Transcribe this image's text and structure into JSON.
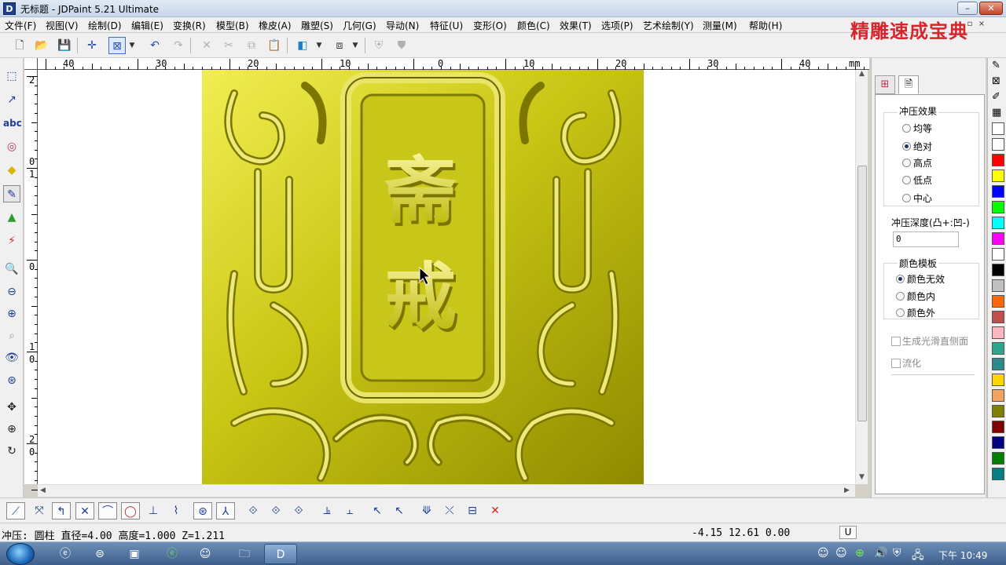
{
  "window": {
    "title": "无标题 - JDPaint 5.21 Ultimate",
    "app_icon": "D",
    "brand_overlay": "精雕速成宝典",
    "controls": [
      "–",
      "❐",
      "✕"
    ]
  },
  "menu": {
    "items": [
      "文件(F)",
      "视图(V)",
      "绘制(D)",
      "编辑(E)",
      "变换(R)",
      "模型(B)",
      "橡皮(A)",
      "雕塑(S)",
      "几何(G)",
      "导动(N)",
      "特征(U)",
      "变形(O)",
      "颜色(C)",
      "效果(T)",
      "选项(P)",
      "艺术绘制(Y)",
      "测量(M)",
      "帮助(H)"
    ]
  },
  "toolbar": {
    "icons": [
      "new-file-icon",
      "open-folder-icon",
      "save-icon",
      "crosshair-icon",
      "select-box-icon",
      "dropdown-icon",
      "undo-icon",
      "redo-icon",
      "delete-icon",
      "cut-icon",
      "copy-icon",
      "paste-icon",
      "color-fill-icon",
      "view-cube-icon",
      "shield-left-icon",
      "shield-right-icon"
    ]
  },
  "rulers": {
    "unit": "mm",
    "h_labels": [
      "40",
      "30",
      "20",
      "10",
      "0",
      "10",
      "20",
      "30",
      "40"
    ],
    "v_labels": [
      "2",
      "0",
      "1",
      "0",
      "0",
      "1",
      "0",
      "2",
      "0"
    ]
  },
  "model": {
    "characters": [
      "斋",
      "戒"
    ],
    "primary_color": "#c8c514",
    "highlight_color": "#f4f07a",
    "shadow_color": "#5f5a00"
  },
  "panel": {
    "tabs": [
      "layers-icon",
      "properties-icon"
    ],
    "stamp_effect": {
      "label": "冲压效果",
      "options": [
        "均等",
        "绝对",
        "高点",
        "低点",
        "中心"
      ],
      "selected": "绝对"
    },
    "stamp_depth": {
      "label": "冲压深度(凸+:凹-)",
      "value": "0"
    },
    "color_template": {
      "label": "颜色模板",
      "options": [
        "颜色无效",
        "颜色内",
        "颜色外"
      ],
      "selected": "颜色无效"
    },
    "checks": [
      "生成光滑直侧面",
      "流化"
    ]
  },
  "palette": {
    "colors": [
      "#ffffff",
      "#ffffff",
      "#ff0000",
      "#ffff00",
      "#0000ff",
      "#00ff00",
      "#00ffff",
      "#ff00ff",
      "#ffffff",
      "#000000",
      "#c0c0c0",
      "#ff6600",
      "#c0504d",
      "#ffb6c1",
      "#2ca58d",
      "#2e8b8b",
      "#ffd700",
      "#f4a460",
      "#808000",
      "#800000",
      "#000080",
      "#008000",
      "#008080"
    ]
  },
  "status": {
    "text": "冲压: 圆柱  直径=4.00  高度=1.000  Z=1.211",
    "coords": "-4.15 12.61 0.00",
    "unit": "U"
  },
  "taskbar": {
    "clock": "下午 10:49"
  }
}
